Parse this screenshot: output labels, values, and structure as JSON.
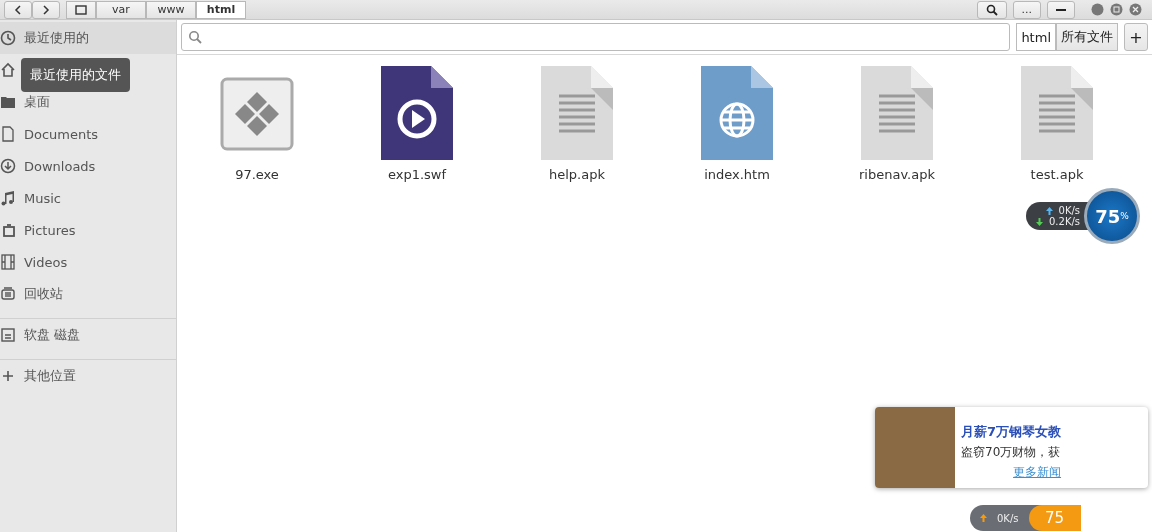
{
  "header": {
    "path": [
      {
        "label": "var",
        "selected": false
      },
      {
        "label": "www",
        "selected": false
      },
      {
        "label": "html",
        "selected": true
      }
    ],
    "more_label": "..."
  },
  "sidebar": {
    "items": [
      {
        "kind": "recent",
        "label": "最近使用的",
        "selected": true
      },
      {
        "kind": "home",
        "selected": false
      },
      {
        "kind": "folder",
        "label": "桌面",
        "selected": false
      },
      {
        "kind": "document",
        "label": "Documents",
        "selected": false
      },
      {
        "kind": "download",
        "label": "Downloads",
        "selected": false
      },
      {
        "kind": "music",
        "label": "Music",
        "selected": false
      },
      {
        "kind": "picture",
        "label": "Pictures",
        "selected": false
      },
      {
        "kind": "video",
        "label": "Videos",
        "selected": false
      },
      {
        "kind": "trash",
        "label": "回收站",
        "selected": false
      },
      {
        "kind": "disk",
        "label": "软盘 磁盘",
        "selected": false,
        "divider_before": true
      },
      {
        "kind": "plus",
        "label": "其他位置",
        "selected": false,
        "divider_before": true
      }
    ],
    "tooltip": "最近使用的文件"
  },
  "search": {
    "filter": "html",
    "file_type": "所有文件",
    "add_label": "+"
  },
  "files": [
    {
      "kind": "exe",
      "name": "97.exe"
    },
    {
      "kind": "video",
      "name": "exp1.swf"
    },
    {
      "kind": "text",
      "name": "help.apk"
    },
    {
      "kind": "web",
      "name": "index.htm"
    },
    {
      "kind": "text",
      "name": "ribenav.apk"
    },
    {
      "kind": "text",
      "name": "test.apk"
    }
  ],
  "net_widget": {
    "up": "0K/s",
    "down": "0.2K/s",
    "value": "75",
    "unit": "%"
  },
  "ad_popup": {
    "headline": "月薪7万钢琴女教",
    "summary": "盗窃70万财物，获",
    "link": "更多新闻"
  },
  "mini_widget": {
    "up": "0K/s",
    "value": "75"
  }
}
